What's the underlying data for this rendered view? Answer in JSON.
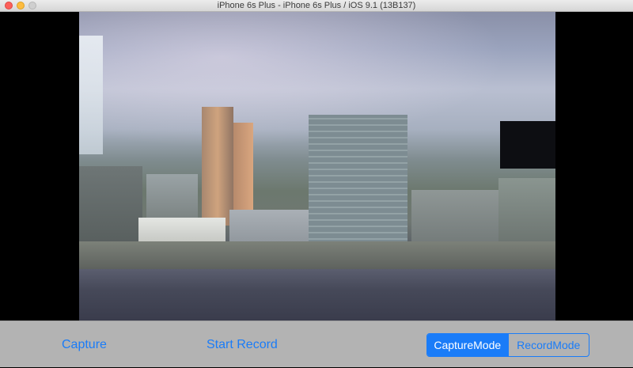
{
  "window": {
    "title": "iPhone 6s Plus - iPhone 6s Plus / iOS 9.1 (13B137)"
  },
  "toolbar": {
    "capture_label": "Capture",
    "start_record_label": "Start Record",
    "mode_selector": {
      "options": [
        "CaptureMode",
        "RecordMode"
      ],
      "selected": "CaptureMode"
    }
  },
  "colors": {
    "accent": "#1a7cf8",
    "toolbar_bg": "#b3b3b3",
    "screen_bg": "#000000"
  }
}
